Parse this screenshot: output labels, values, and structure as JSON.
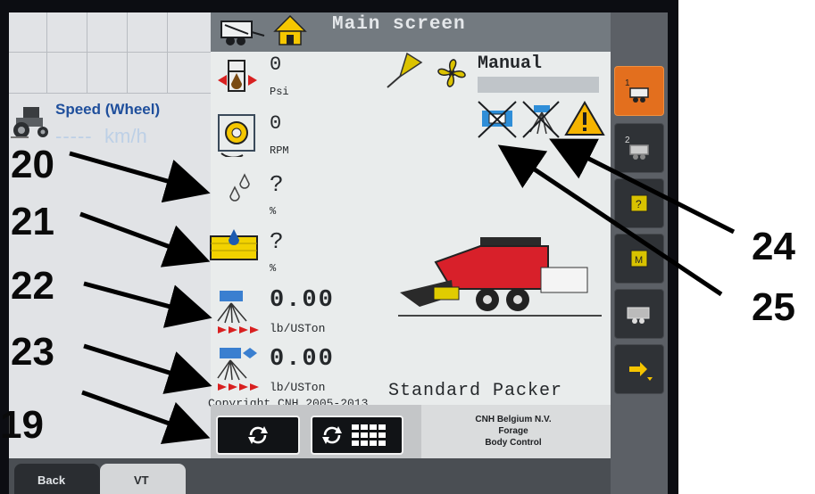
{
  "title": "Main screen",
  "speed": {
    "label": "Speed (Wheel)",
    "value": "-----",
    "unit": "km/h"
  },
  "gauges": {
    "pressure": {
      "value": "0",
      "unit": "Psi"
    },
    "flywheel": {
      "value": "0",
      "unit": "RPM"
    },
    "moisture_sensor": {
      "value": "?",
      "unit": "%"
    },
    "bale_moisture": {
      "value": "?",
      "unit": "%"
    },
    "applicator_rate_1": {
      "value": "0.00",
      "unit": "lb/USTon"
    },
    "applicator_rate_2": {
      "value": "0.00",
      "unit": "lb/USTon"
    }
  },
  "mode_label": "Manual",
  "baler_name": "Standard Packer",
  "copyright": "Copyright CNH 2005-2013",
  "body_control": {
    "line1": "CNH Belgium N.V.",
    "line2": "Forage",
    "line3": "Body Control"
  },
  "tabs": {
    "back": "Back",
    "vt": "VT"
  },
  "callouts": {
    "c19": "19",
    "c20": "20",
    "c21": "21",
    "c22": "22",
    "c23": "23",
    "c24": "24",
    "c25": "25"
  },
  "colors": {
    "active_softkey": "#e36f1e",
    "baler_red": "#d8202a",
    "warning": "#f5b400"
  },
  "icons": [
    "baler-icon",
    "home-icon",
    "pressure-icon",
    "flywheel-icon",
    "droplet-icon",
    "bale-moisture-icon",
    "applicator-icon",
    "fan-icon",
    "sensor-off-icon",
    "applicator-off-icon",
    "warning-icon",
    "refresh-icon",
    "grid-icon"
  ]
}
